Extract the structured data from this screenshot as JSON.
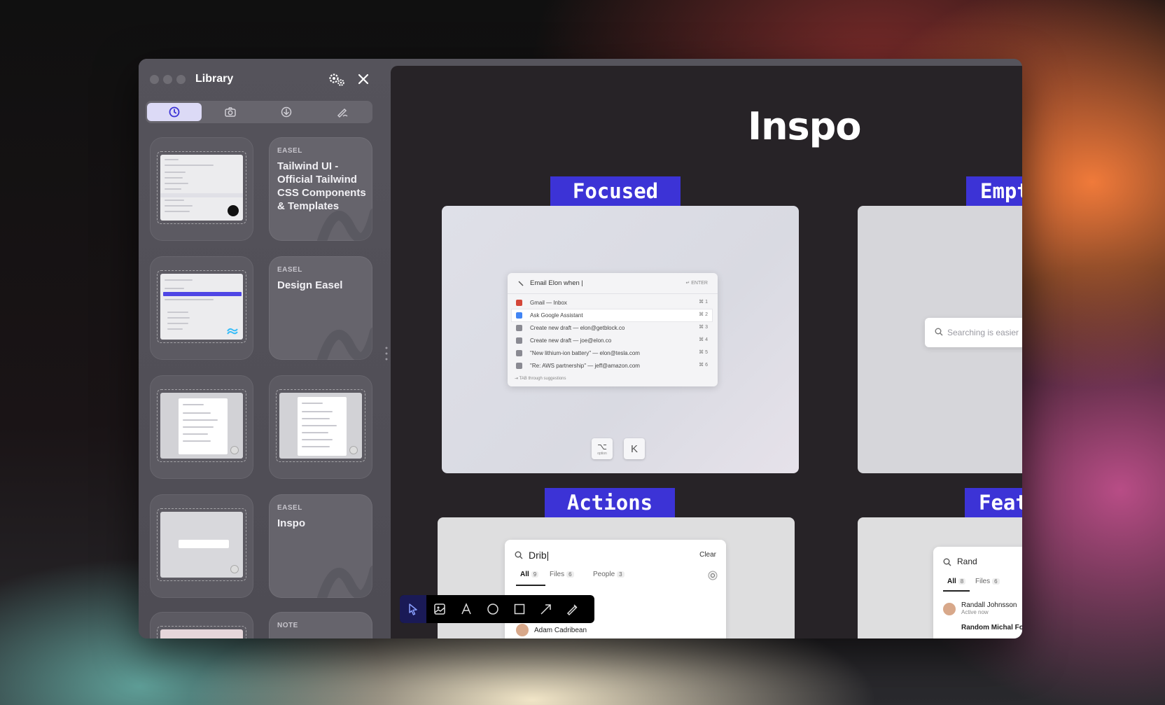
{
  "sidebar": {
    "title": "Library",
    "tabs": [
      {
        "name": "recent",
        "icon": "clock-icon",
        "active": true
      },
      {
        "name": "captures",
        "icon": "camera-icon",
        "active": false
      },
      {
        "name": "downloads",
        "icon": "download-icon",
        "active": false
      },
      {
        "name": "notes",
        "icon": "pen-icon",
        "active": false
      }
    ],
    "cards": [
      {
        "type": "thumb"
      },
      {
        "type": "easel",
        "kind": "EASEL",
        "title": "Tailwind UI - Official Tailwind CSS Components & Templates"
      },
      {
        "type": "thumb"
      },
      {
        "type": "easel",
        "kind": "EASEL",
        "title": "Design Easel"
      },
      {
        "type": "thumb"
      },
      {
        "type": "thumb"
      },
      {
        "type": "thumb"
      },
      {
        "type": "easel",
        "kind": "EASEL",
        "title": "Inspo"
      },
      {
        "type": "thumb"
      },
      {
        "type": "note",
        "kind": "NOTE"
      }
    ]
  },
  "canvas": {
    "logo": "Inspo",
    "labels": {
      "focused": "Focused",
      "empty": "Empt",
      "actions": "Actions",
      "features": "Feat"
    },
    "focused_panel": {
      "query": "Email Elon when |",
      "enter_hint": "↵ ENTER",
      "rows": [
        {
          "text": "Gmail — Inbox",
          "kbd": "⌘ 1",
          "selected": false
        },
        {
          "text": "Ask Google Assistant",
          "kbd": "⌘ 2",
          "selected": true
        },
        {
          "text": "Create new draft — elon@getblock.co",
          "kbd": "⌘ 3",
          "selected": false
        },
        {
          "text": "Create new draft — joe@elon.co",
          "kbd": "⌘ 4",
          "selected": false
        },
        {
          "text": "\"New lithium-ion battery\" — elon@tesla.com",
          "kbd": "⌘ 5",
          "selected": false
        },
        {
          "text": "\"Re: AWS partnership\" — jeff@amazon.com",
          "kbd": "⌘ 6",
          "selected": false
        }
      ],
      "footer": "⇥ TAB through suggestions",
      "key1": "⌥",
      "key1_sub": "option",
      "key2": "K"
    },
    "empty_panel": {
      "placeholder": "Searching is easier"
    },
    "actions_panel": {
      "query": "Drib|",
      "clear": "Clear",
      "tabs": [
        {
          "label": "All",
          "count": "9"
        },
        {
          "label": "Files",
          "count": "6"
        },
        {
          "label": "People",
          "count": "3"
        }
      ],
      "person": "Adam Cadribean"
    },
    "features_panel": {
      "query": "Rand",
      "tabs": [
        {
          "label": "All",
          "count": "8"
        },
        {
          "label": "Files",
          "count": "6"
        }
      ],
      "person": "Randall Johnsson",
      "status": "Active now",
      "person2": "Random Michal Folde"
    }
  },
  "toolbar": {
    "tools": [
      "cursor-icon",
      "image-icon",
      "text-icon",
      "circle-icon",
      "square-icon",
      "arrow-icon",
      "pen-icon"
    ]
  },
  "colors": {
    "accent": "#3c33d6",
    "sidebar_bg": "#55535b",
    "canvas_bg": "#272327",
    "active_tab": "#dcdaf6"
  }
}
